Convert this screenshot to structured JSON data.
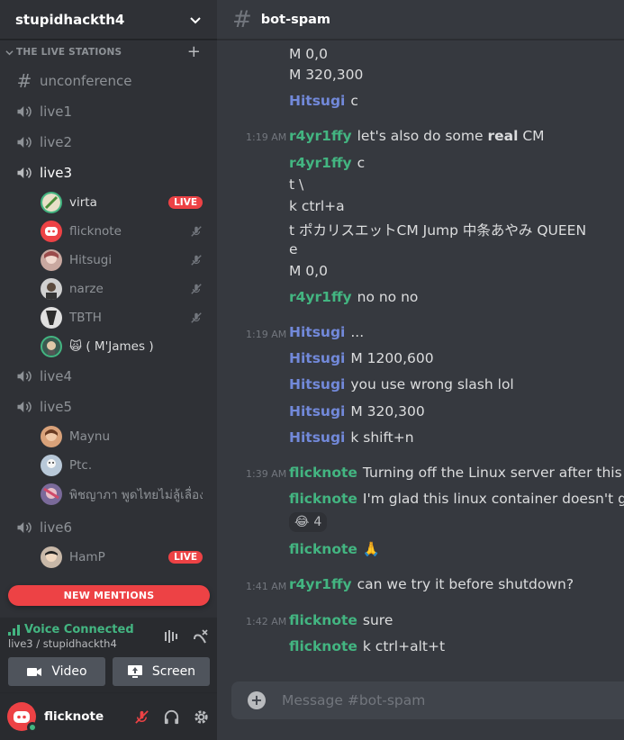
{
  "colors": {
    "author_blue": "#7289da",
    "author_green": "#43b581",
    "live_red": "#ed4245",
    "voice_green": "#43b581"
  },
  "guild": {
    "name": "stupidhackth4"
  },
  "category": {
    "name": "THE LIVE STATIONS"
  },
  "channels": {
    "text": "unconference",
    "live1": "live1",
    "live2": "live2",
    "live3": "live3",
    "live4": "live4",
    "live5": "live5",
    "live6": "live6"
  },
  "live3_users": [
    {
      "name": "virta",
      "badge": "LIVE"
    },
    {
      "name": "flicknote"
    },
    {
      "name": "Hitsugi"
    },
    {
      "name": "narze"
    },
    {
      "name": "TBTH"
    },
    {
      "name": "🙀 ( M'James )"
    }
  ],
  "live5_users": [
    {
      "name": "Maynu"
    },
    {
      "name": "Ptc."
    },
    {
      "name": "พิชญาภา พูดไทยไม่ลู้เลื่อง"
    }
  ],
  "live6_users": [
    {
      "name": "HamP",
      "badge": "LIVE"
    }
  ],
  "new_mentions": "NEW MENTIONS",
  "voice": {
    "status": "Voice Connected",
    "location": "live3 / stupidhackth4",
    "video_label": "Video",
    "screen_label": "Screen"
  },
  "user_panel": {
    "name": "flicknote"
  },
  "channel_header": {
    "name": "bot-spam"
  },
  "messages": {
    "m1": "M 0,0",
    "m2": "M 320,300",
    "m3_author": "Hitsugi",
    "m3_text": "c",
    "m4_time": "1:19 AM",
    "m4_author": "r4yr1ffy",
    "m4_pre": "let's also do some ",
    "m4_bold": "real",
    "m4_post": " CM",
    "m5_author": "r4yr1ffy",
    "m5_text": "c",
    "m6": "t \\",
    "m7": "k ctrl+a",
    "m8": "t ポカリスエットCM  Jump 中条あやみ QUEEN",
    "m9": "e",
    "m10": "M 0,0",
    "m11_author": "r4yr1ffy",
    "m11_text": "no no no",
    "m12_time": "1:19 AM",
    "m12_author": "Hitsugi",
    "m12_text": "...",
    "m13_author": "Hitsugi",
    "m13_text": "M 1200,600",
    "m14_author": "Hitsugi",
    "m14_text": "you use wrong slash lol",
    "m15_author": "Hitsugi",
    "m15_text": "M 320,300",
    "m16_author": "Hitsugi",
    "m16_text": "k shift+n",
    "m17_time": "1:39 AM",
    "m17_author": "flicknote",
    "m17_text": "Turning off the Linux server after this so",
    "m18_author": "flicknote",
    "m18_text": "I'm glad this linux container doesn't get",
    "reaction_emoji": "😂",
    "reaction_count": "4",
    "m19_author": "flicknote",
    "m19_text": "🙏",
    "m20_time": "1:41 AM",
    "m20_author": "r4yr1ffy",
    "m20_text": "can we try it before shutdown?",
    "m21_time": "1:42 AM",
    "m21_author": "flicknote",
    "m21_text": "sure",
    "m22_author": "flicknote",
    "m22_text": "k ctrl+alt+t"
  },
  "composer": {
    "placeholder": "Message #bot-spam"
  }
}
